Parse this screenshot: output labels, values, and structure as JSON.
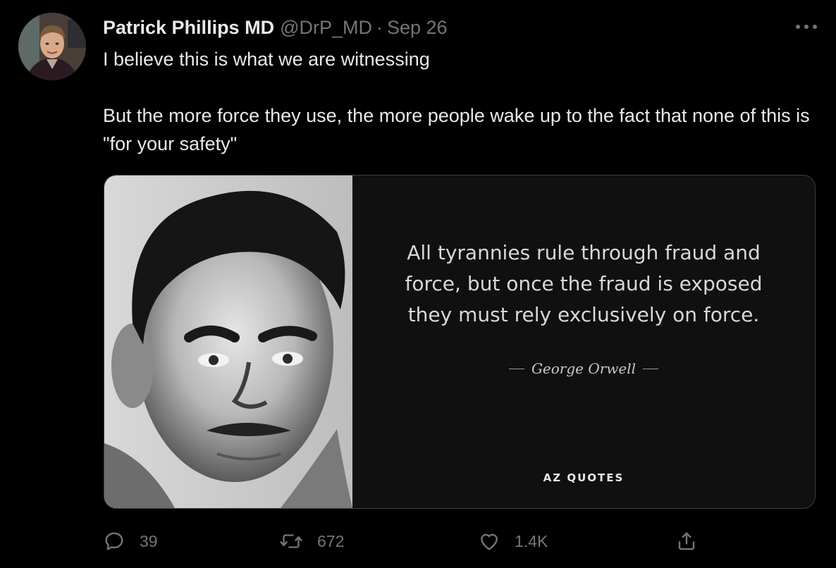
{
  "author": {
    "display_name": "Patrick Phillips MD",
    "handle": "@DrP_MD",
    "separator": "·",
    "date": "Sep 26"
  },
  "tweet": {
    "line1": "I believe this is what we are witnessing",
    "line2": "But the more force they use, the more people wake up to the fact that none of this is \"for your safety\""
  },
  "media": {
    "quote_lines": [
      "All tyrannies rule through fraud and",
      "force, but once the fraud is exposed",
      "they must rely exclusively on force."
    ],
    "quote_author": "George Orwell",
    "brand": "AZ QUOTES"
  },
  "actions": {
    "reply_count": "39",
    "retweet_count": "672",
    "like_count": "1.4K"
  },
  "icons": {
    "more": "more-dots-icon",
    "reply": "reply-icon",
    "retweet": "retweet-icon",
    "like": "heart-icon",
    "share": "share-icon"
  },
  "colors": {
    "background": "#000000",
    "text": "#e7e9ea",
    "muted": "#71767b"
  }
}
